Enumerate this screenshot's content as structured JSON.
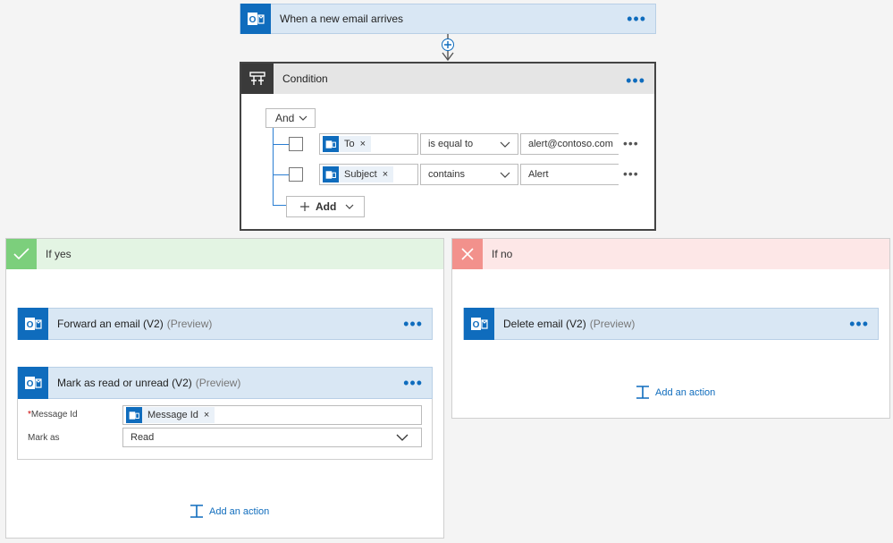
{
  "trigger": {
    "title": "When a new email arrives",
    "more": "•••"
  },
  "condition": {
    "title": "Condition",
    "more": "•••",
    "group_operator": "And",
    "rows": [
      {
        "token": "To",
        "operator": "is equal to",
        "value": "alert@contoso.com",
        "more": "•••"
      },
      {
        "token": "Subject",
        "operator": "contains",
        "value": "Alert",
        "more": "•••"
      }
    ],
    "add_label": "Add"
  },
  "if_yes": {
    "label": "If yes",
    "actions": [
      {
        "title": "Forward an email (V2)",
        "preview": "(Preview)",
        "more": "•••"
      },
      {
        "title": "Mark as read or unread (V2)",
        "preview": "(Preview)",
        "more": "•••",
        "fields": [
          {
            "required_mark": "*",
            "label": "Message Id",
            "token": "Message Id"
          },
          {
            "label": "Mark as",
            "value": "Read"
          }
        ]
      }
    ],
    "add_action": "Add an action"
  },
  "if_no": {
    "label": "If no",
    "actions": [
      {
        "title": "Delete email (V2)",
        "preview": "(Preview)",
        "more": "•••"
      }
    ],
    "add_action": "Add an action"
  },
  "colors": {
    "outlook_blue": "#0f6cbd",
    "card_header": "#d9e7f4",
    "yes_header": "#e3f4e3",
    "yes_icon": "#7ccf7c",
    "no_header": "#fde7e7",
    "no_icon": "#f2918c",
    "link": "#0f6cbd"
  },
  "icons": [
    "outlook-icon",
    "condition-icon",
    "plus-icon",
    "check-icon",
    "x-icon",
    "add-action-icon",
    "chevron-down-icon"
  ]
}
